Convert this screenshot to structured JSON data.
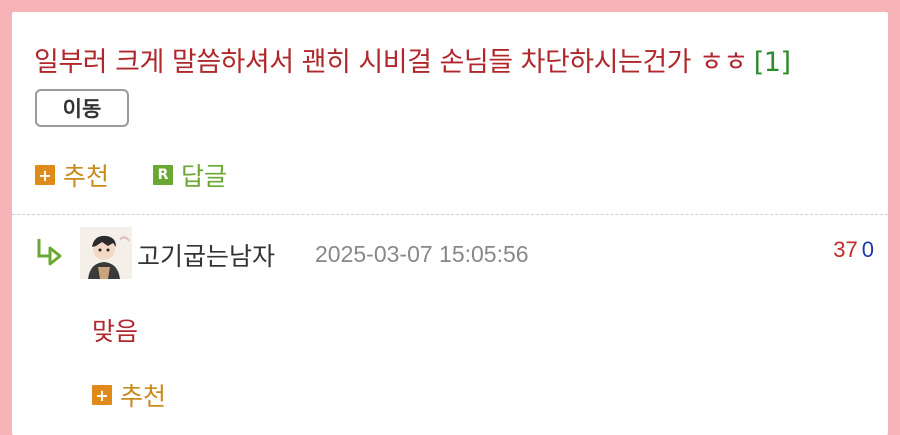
{
  "post": {
    "title": "일부러 크게 말씀하셔서 괜히 시비걸 손님들 차단하시는건가 ㅎㅎ",
    "reply_count": "[1]",
    "move_label": "이동",
    "recommend_label": "추천",
    "reply_label": "답글",
    "reply_icon_letter": "R"
  },
  "comment": {
    "nickname": "고기굽는남자",
    "datetime": "2025-03-07 15:05:56",
    "upvotes": "37",
    "downvotes": "0",
    "text": "맞음",
    "recommend_label": "추천"
  },
  "colors": {
    "background_pink": "#f6b3b8",
    "title_red": "#b0282c",
    "count_green": "#2e8a2e",
    "action_orange": "#e08a1a",
    "action_green": "#6aa833"
  },
  "icons": [
    "plus-icon",
    "reply-r-icon",
    "reply-arrow-icon",
    "avatar"
  ]
}
